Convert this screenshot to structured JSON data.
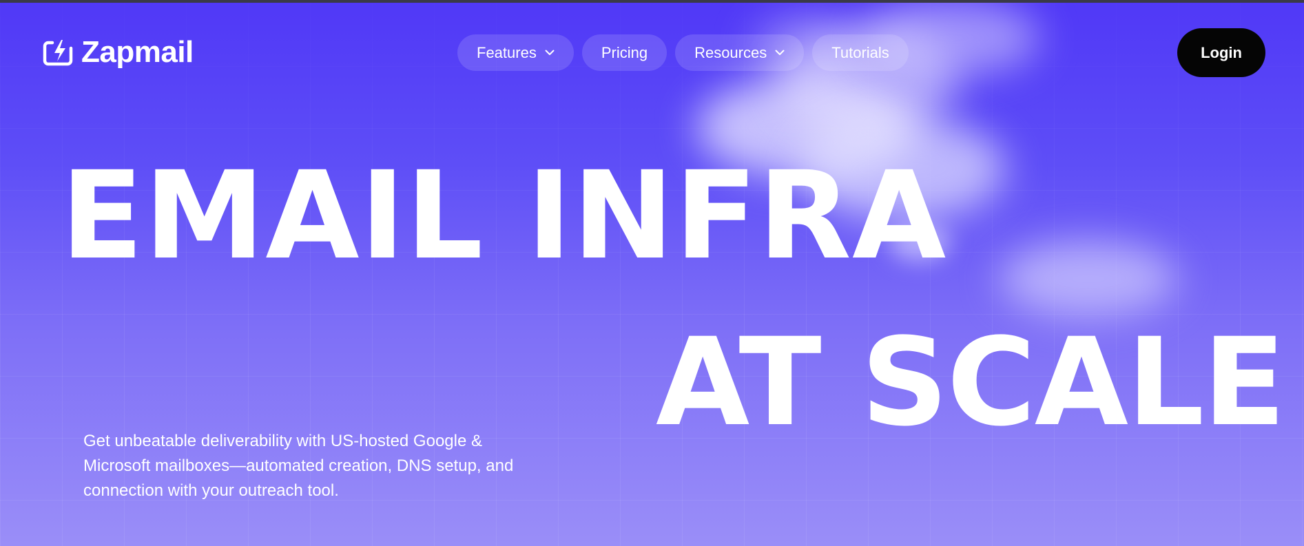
{
  "brand": {
    "name": "Zapmail",
    "logo_icon": "lightning-refresh-icon"
  },
  "nav": {
    "features": "Features",
    "pricing": "Pricing",
    "resources": "Resources",
    "tutorials": "Tutorials"
  },
  "login_label": "Login",
  "hero": {
    "line1": "EMAIL INFRA",
    "line2": "AT SCALE",
    "description": "Get unbeatable deliverability with US-hosted Google & Microsoft mailboxes—automated creation, DNS setup, and connection with your outreach tool."
  },
  "colors": {
    "background_top": "#5038f7",
    "background_bottom": "#9a8ef8",
    "login_button": "#050505",
    "text": "#ffffff"
  }
}
